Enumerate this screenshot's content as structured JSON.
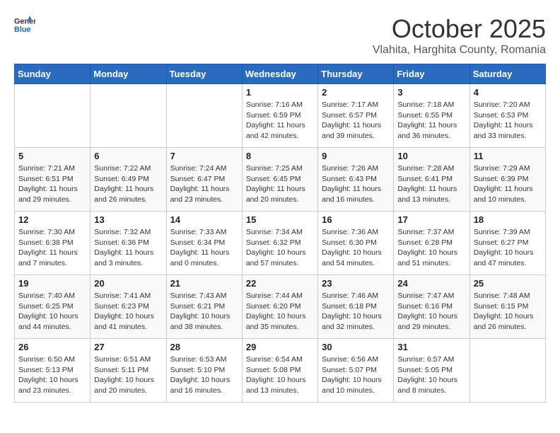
{
  "header": {
    "logo_general": "General",
    "logo_blue": "Blue",
    "month_title": "October 2025",
    "location": "Vlahita, Harghita County, Romania"
  },
  "weekdays": [
    "Sunday",
    "Monday",
    "Tuesday",
    "Wednesday",
    "Thursday",
    "Friday",
    "Saturday"
  ],
  "weeks": [
    [
      {
        "day": "",
        "info": ""
      },
      {
        "day": "",
        "info": ""
      },
      {
        "day": "",
        "info": ""
      },
      {
        "day": "1",
        "info": "Sunrise: 7:16 AM\nSunset: 6:59 PM\nDaylight: 11 hours and 42 minutes."
      },
      {
        "day": "2",
        "info": "Sunrise: 7:17 AM\nSunset: 6:57 PM\nDaylight: 11 hours and 39 minutes."
      },
      {
        "day": "3",
        "info": "Sunrise: 7:18 AM\nSunset: 6:55 PM\nDaylight: 11 hours and 36 minutes."
      },
      {
        "day": "4",
        "info": "Sunrise: 7:20 AM\nSunset: 6:53 PM\nDaylight: 11 hours and 33 minutes."
      }
    ],
    [
      {
        "day": "5",
        "info": "Sunrise: 7:21 AM\nSunset: 6:51 PM\nDaylight: 11 hours and 29 minutes."
      },
      {
        "day": "6",
        "info": "Sunrise: 7:22 AM\nSunset: 6:49 PM\nDaylight: 11 hours and 26 minutes."
      },
      {
        "day": "7",
        "info": "Sunrise: 7:24 AM\nSunset: 6:47 PM\nDaylight: 11 hours and 23 minutes."
      },
      {
        "day": "8",
        "info": "Sunrise: 7:25 AM\nSunset: 6:45 PM\nDaylight: 11 hours and 20 minutes."
      },
      {
        "day": "9",
        "info": "Sunrise: 7:26 AM\nSunset: 6:43 PM\nDaylight: 11 hours and 16 minutes."
      },
      {
        "day": "10",
        "info": "Sunrise: 7:28 AM\nSunset: 6:41 PM\nDaylight: 11 hours and 13 minutes."
      },
      {
        "day": "11",
        "info": "Sunrise: 7:29 AM\nSunset: 6:39 PM\nDaylight: 11 hours and 10 minutes."
      }
    ],
    [
      {
        "day": "12",
        "info": "Sunrise: 7:30 AM\nSunset: 6:38 PM\nDaylight: 11 hours and 7 minutes."
      },
      {
        "day": "13",
        "info": "Sunrise: 7:32 AM\nSunset: 6:36 PM\nDaylight: 11 hours and 3 minutes."
      },
      {
        "day": "14",
        "info": "Sunrise: 7:33 AM\nSunset: 6:34 PM\nDaylight: 11 hours and 0 minutes."
      },
      {
        "day": "15",
        "info": "Sunrise: 7:34 AM\nSunset: 6:32 PM\nDaylight: 10 hours and 57 minutes."
      },
      {
        "day": "16",
        "info": "Sunrise: 7:36 AM\nSunset: 6:30 PM\nDaylight: 10 hours and 54 minutes."
      },
      {
        "day": "17",
        "info": "Sunrise: 7:37 AM\nSunset: 6:28 PM\nDaylight: 10 hours and 51 minutes."
      },
      {
        "day": "18",
        "info": "Sunrise: 7:39 AM\nSunset: 6:27 PM\nDaylight: 10 hours and 47 minutes."
      }
    ],
    [
      {
        "day": "19",
        "info": "Sunrise: 7:40 AM\nSunset: 6:25 PM\nDaylight: 10 hours and 44 minutes."
      },
      {
        "day": "20",
        "info": "Sunrise: 7:41 AM\nSunset: 6:23 PM\nDaylight: 10 hours and 41 minutes."
      },
      {
        "day": "21",
        "info": "Sunrise: 7:43 AM\nSunset: 6:21 PM\nDaylight: 10 hours and 38 minutes."
      },
      {
        "day": "22",
        "info": "Sunrise: 7:44 AM\nSunset: 6:20 PM\nDaylight: 10 hours and 35 minutes."
      },
      {
        "day": "23",
        "info": "Sunrise: 7:46 AM\nSunset: 6:18 PM\nDaylight: 10 hours and 32 minutes."
      },
      {
        "day": "24",
        "info": "Sunrise: 7:47 AM\nSunset: 6:16 PM\nDaylight: 10 hours and 29 minutes."
      },
      {
        "day": "25",
        "info": "Sunrise: 7:48 AM\nSunset: 6:15 PM\nDaylight: 10 hours and 26 minutes."
      }
    ],
    [
      {
        "day": "26",
        "info": "Sunrise: 6:50 AM\nSunset: 5:13 PM\nDaylight: 10 hours and 23 minutes."
      },
      {
        "day": "27",
        "info": "Sunrise: 6:51 AM\nSunset: 5:11 PM\nDaylight: 10 hours and 20 minutes."
      },
      {
        "day": "28",
        "info": "Sunrise: 6:53 AM\nSunset: 5:10 PM\nDaylight: 10 hours and 16 minutes."
      },
      {
        "day": "29",
        "info": "Sunrise: 6:54 AM\nSunset: 5:08 PM\nDaylight: 10 hours and 13 minutes."
      },
      {
        "day": "30",
        "info": "Sunrise: 6:56 AM\nSunset: 5:07 PM\nDaylight: 10 hours and 10 minutes."
      },
      {
        "day": "31",
        "info": "Sunrise: 6:57 AM\nSunset: 5:05 PM\nDaylight: 10 hours and 8 minutes."
      },
      {
        "day": "",
        "info": ""
      }
    ]
  ]
}
